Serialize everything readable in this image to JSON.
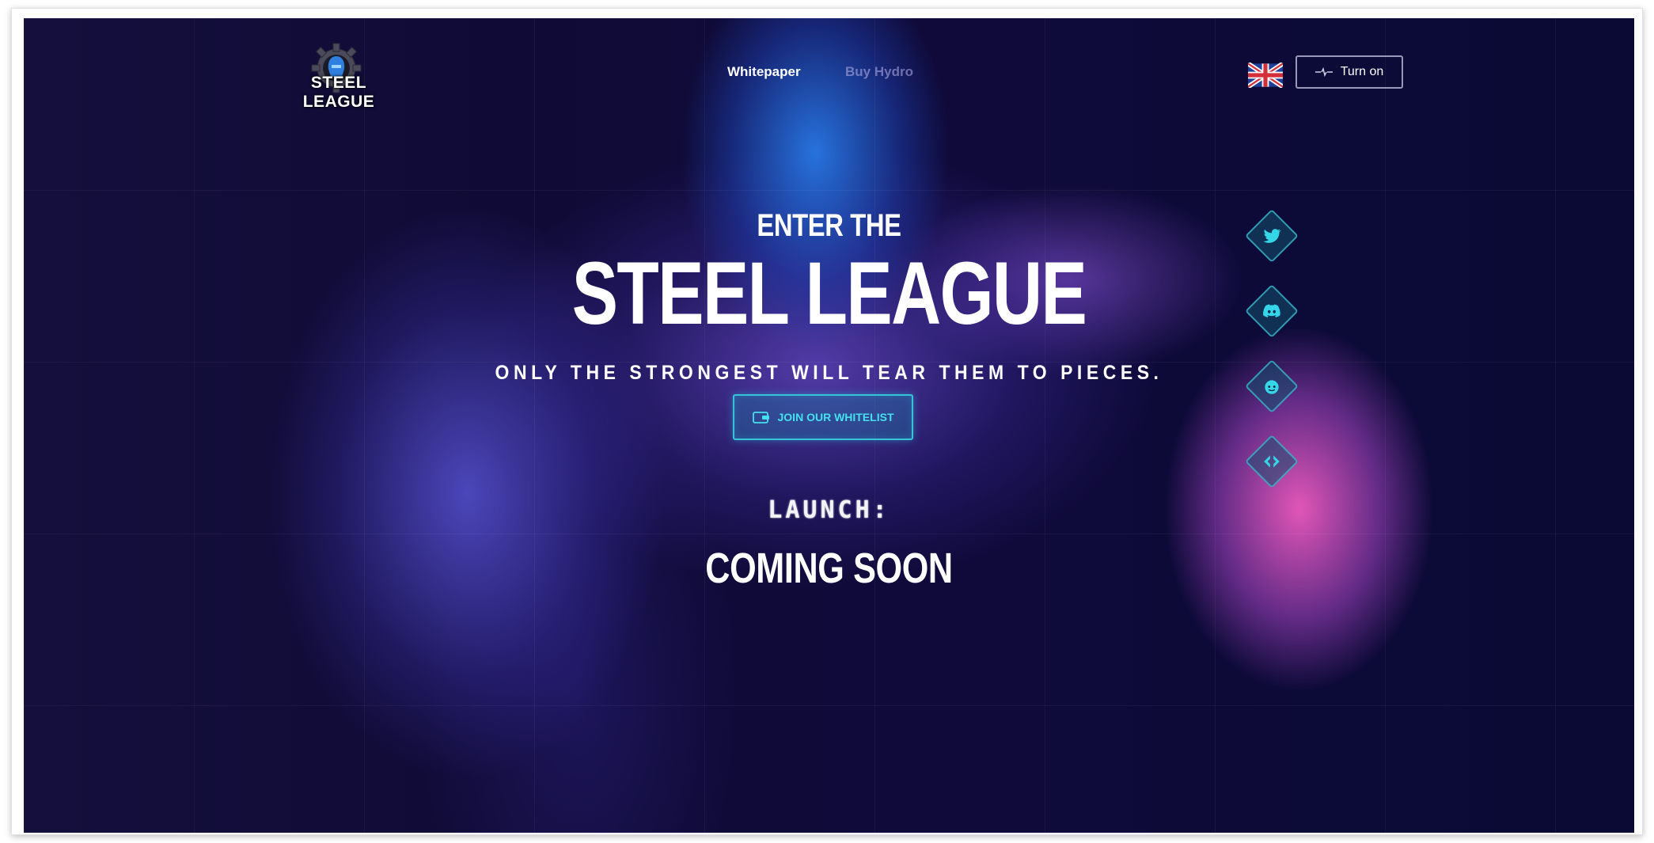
{
  "brand": {
    "logo_text": "STEEL LEAGUE",
    "accent_color": "#35c4d8"
  },
  "nav": {
    "whitepaper": "Whitepaper",
    "buy_hydro": "Buy Hydro",
    "language_flag": "uk-flag-icon",
    "sound_button": "Turn on"
  },
  "hero": {
    "pre_title": "ENTER THE",
    "title": "STEEL LEAGUE",
    "subtitle": "ONLY THE STRONGEST WILL TEAR THEM TO PIECES.",
    "cta_label": "JOIN OUR WHITELIST",
    "launch_label": "LAUNCH:",
    "launch_value": "COMING SOON"
  },
  "social": [
    {
      "icon": "twitter-icon"
    },
    {
      "icon": "discord-icon"
    },
    {
      "icon": "reddit-icon"
    },
    {
      "icon": "gitbook-icon"
    }
  ]
}
